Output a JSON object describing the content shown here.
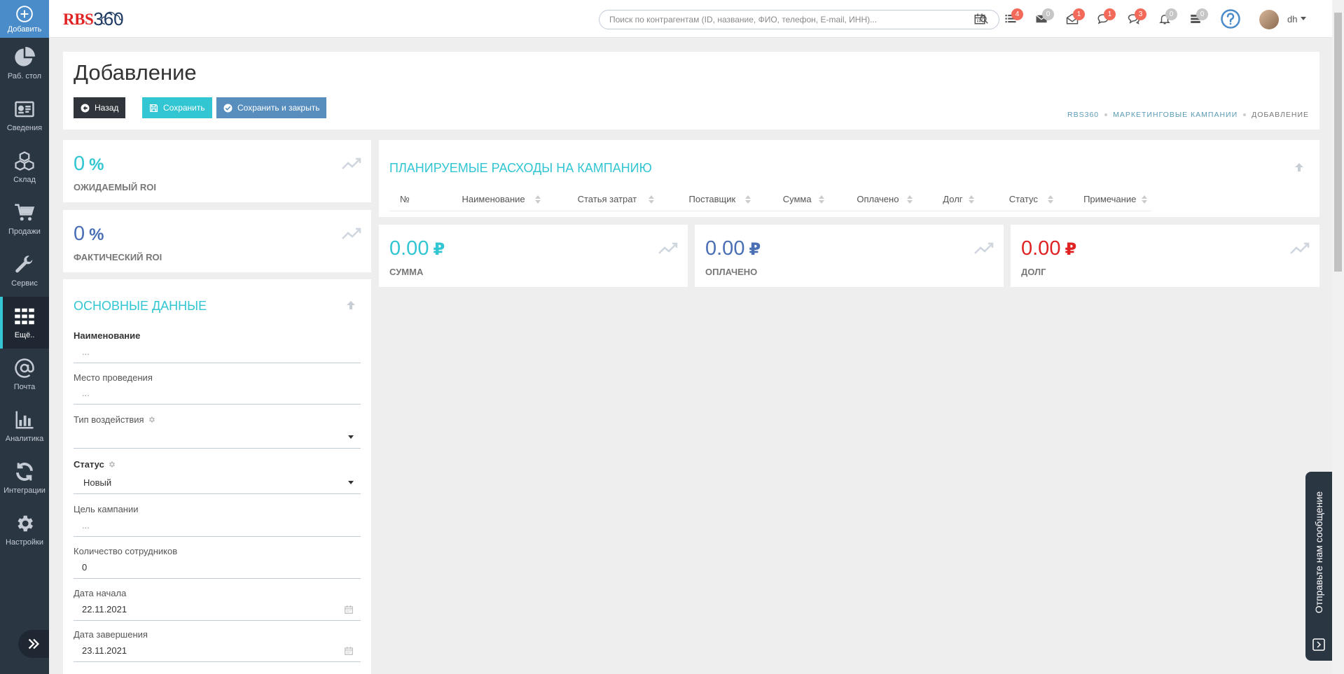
{
  "sidebar": {
    "add": "Добавить",
    "items": [
      {
        "label": "Раб. стол",
        "icon": "pie-chart-icon"
      },
      {
        "label": "Сведения",
        "icon": "id-card-icon"
      },
      {
        "label": "Склад",
        "icon": "cubes-icon"
      },
      {
        "label": "Продажи",
        "icon": "cart-icon"
      },
      {
        "label": "Сервис",
        "icon": "wrench-icon"
      },
      {
        "label": "Ещё..",
        "icon": "grid-icon",
        "active": true
      },
      {
        "label": "Почта",
        "icon": "at-icon"
      },
      {
        "label": "Аналитика",
        "icon": "bar-chart-icon"
      },
      {
        "label": "Интеграции",
        "icon": "refresh-icon"
      },
      {
        "label": "Настройки",
        "icon": "gear-icon"
      }
    ]
  },
  "header": {
    "logo_rbs": "RBS",
    "logo_num": "360",
    "search_placeholder": "Поиск по контрагентам (ID, название, ФИО, телефон, E-mail, ИНН)...",
    "badges": [
      "4",
      "0",
      "1",
      "1",
      "3",
      "0",
      "0"
    ],
    "user": "dh"
  },
  "page": {
    "title": "Добавление",
    "btn_back": "Назад",
    "btn_save": "Сохранить",
    "btn_save_close": "Сохранить и закрыть",
    "breadcrumb": [
      "RBS360",
      "МАРКЕТИНГОВЫЕ КАМПАНИИ",
      "ДОБАВЛЕНИЕ"
    ]
  },
  "roi": {
    "expected_value": "0",
    "expected_unit": "%",
    "expected_label": "ОЖИДАЕМЫЙ ROI",
    "actual_value": "0",
    "actual_unit": "%",
    "actual_label": "ФАКТИЧЕСКИЙ ROI"
  },
  "expenses": {
    "title": "ПЛАНИРУЕМЫЕ РАСХОДЫ НА КАМПАНИЮ",
    "columns": [
      "№",
      "Наименование",
      "Статья затрат",
      "Поставщик",
      "Сумма",
      "Оплачено",
      "Долг",
      "Статус",
      "Примечание"
    ]
  },
  "totals": {
    "sum_value": "0.00",
    "sum_label": "СУММА",
    "paid_value": "0.00",
    "paid_label": "ОПЛАЧЕНО",
    "debt_value": "0.00",
    "debt_label": "ДОЛГ",
    "currency": "₽"
  },
  "form": {
    "title": "ОСНОВНЫЕ ДАННЫЕ",
    "name_label": "Наименование",
    "name_value": "...",
    "place_label": "Место проведения",
    "place_value": "...",
    "type_label": "Тип воздействия",
    "type_value": "",
    "status_label": "Статус",
    "status_value": "Новый",
    "goal_label": "Цель кампании",
    "goal_value": "...",
    "staff_label": "Количество сотрудников",
    "staff_value": "0",
    "start_label": "Дата начала",
    "start_value": "22.11.2021",
    "end_label": "Дата завершения",
    "end_value": "23.11.2021"
  },
  "feedback": "Отправьте нам сообщение",
  "colors": {
    "teal": "#32c5d2",
    "blue": "#4a6fb5",
    "red": "#e02222",
    "sidebar": "#2b3643"
  }
}
